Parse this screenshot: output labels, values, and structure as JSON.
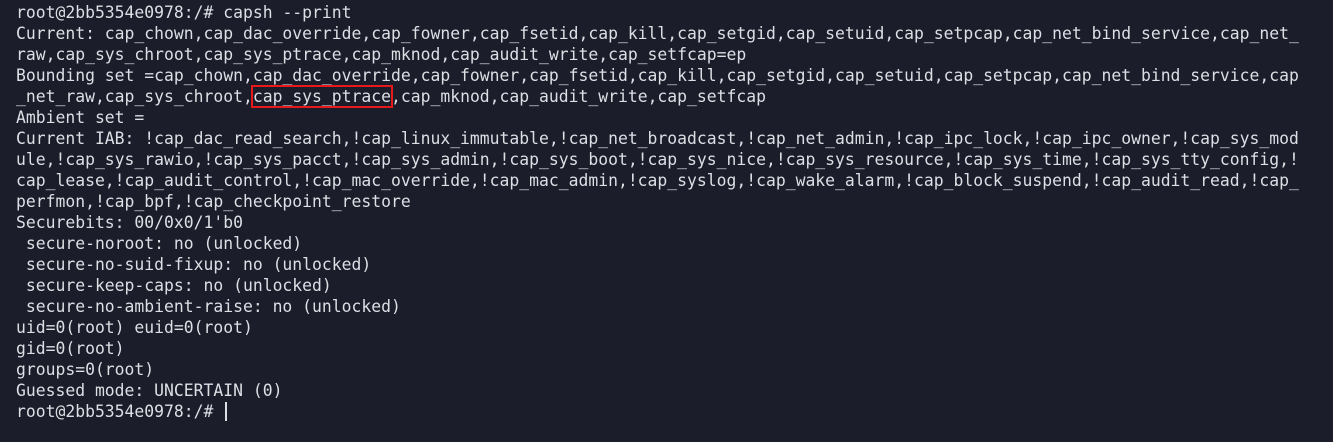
{
  "terminal": {
    "prompt": "root@2bb5354e0978:/# ",
    "command": "capsh --print",
    "lines": [
      "Current: cap_chown,cap_dac_override,cap_fowner,cap_fsetid,cap_kill,cap_setgid,cap_setuid,cap_setpcap,cap_net_bind_service,cap_net_",
      "raw,cap_sys_chroot,cap_sys_ptrace,cap_mknod,cap_audit_write,cap_setfcap=ep",
      "Bounding set =cap_chown,cap_dac_override,cap_fowner,cap_fsetid,cap_kill,cap_setgid,cap_setuid,cap_setpcap,cap_net_bind_service,cap"
    ],
    "bounding_line2": {
      "before": "_net_raw,cap_sys_chroot,",
      "highlight": "cap_sys_ptrace",
      "after": ",cap_mknod,cap_audit_write,cap_setfcap"
    },
    "lines_after": [
      "Ambient set =",
      "Current IAB: !cap_dac_read_search,!cap_linux_immutable,!cap_net_broadcast,!cap_net_admin,!cap_ipc_lock,!cap_ipc_owner,!cap_sys_mod",
      "ule,!cap_sys_rawio,!cap_sys_pacct,!cap_sys_admin,!cap_sys_boot,!cap_sys_nice,!cap_sys_resource,!cap_sys_time,!cap_sys_tty_config,!",
      "cap_lease,!cap_audit_control,!cap_mac_override,!cap_mac_admin,!cap_syslog,!cap_wake_alarm,!cap_block_suspend,!cap_audit_read,!cap_",
      "perfmon,!cap_bpf,!cap_checkpoint_restore",
      "Securebits: 00/0x0/1'b0",
      " secure-noroot: no (unlocked)",
      " secure-no-suid-fixup: no (unlocked)",
      " secure-keep-caps: no (unlocked)",
      " secure-no-ambient-raise: no (unlocked)",
      "uid=0(root) euid=0(root)",
      "gid=0(root)",
      "groups=0(root)",
      "Guessed mode: UNCERTAIN (0)"
    ],
    "final_prompt": "root@2bb5354e0978:/# "
  },
  "colors": {
    "background": "#1b1d2a",
    "foreground": "#dcdfe4",
    "highlight_box": "#e8191b"
  }
}
